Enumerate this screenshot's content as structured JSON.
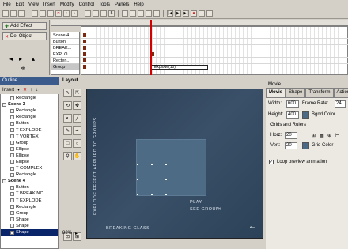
{
  "menu": [
    "File",
    "Edit",
    "View",
    "Insert",
    "Modify",
    "Control",
    "Tools",
    "Panels",
    "Help"
  ],
  "timeline": {
    "add_effect": "Add Effect",
    "del_object": "Del Object",
    "layers": [
      "Scene 4",
      "Button",
      "BREAK...",
      "EXPLO...",
      "Recten...",
      "Group"
    ],
    "tween_label": "Explode(10)"
  },
  "outline": {
    "title": "Outline",
    "insert_label": "Insert",
    "rows": [
      {
        "label": "Rectangle",
        "type": "item"
      },
      {
        "label": "Scene 3",
        "type": "scene"
      },
      {
        "label": "Rectangle",
        "type": "item"
      },
      {
        "label": "Rectangle",
        "type": "item"
      },
      {
        "label": "Button",
        "type": "item"
      },
      {
        "label": "T EXPLODE",
        "type": "item"
      },
      {
        "label": "T VORTEX",
        "type": "item"
      },
      {
        "label": "Group",
        "type": "item"
      },
      {
        "label": "Ellipse",
        "type": "item"
      },
      {
        "label": "Ellipse",
        "type": "item"
      },
      {
        "label": "Ellipse",
        "type": "item"
      },
      {
        "label": "T COMPLEX",
        "type": "item"
      },
      {
        "label": "Rectangle",
        "type": "item"
      },
      {
        "label": "Scene 4",
        "type": "scene"
      },
      {
        "label": "Button",
        "type": "item"
      },
      {
        "label": "T BREAKINC",
        "type": "item"
      },
      {
        "label": "T EXPLODE",
        "type": "item"
      },
      {
        "label": "Rectangle",
        "type": "item"
      },
      {
        "label": "Group",
        "type": "item"
      },
      {
        "label": "Shape",
        "type": "item"
      },
      {
        "label": "Shape",
        "type": "item"
      },
      {
        "label": "Shape",
        "type": "sel"
      }
    ]
  },
  "layout": {
    "title": "Layout",
    "zoom": "82%",
    "stage_vertical_text": "EXPLODE EFFECT APPLIED TO GROUPS",
    "play_label": "PLAY",
    "see_group_label": "SEE GROUP",
    "breaking_glass_label": "BREAKING GLASS"
  },
  "movie": {
    "title": "Movie",
    "tabs": [
      "Movie",
      "Shape",
      "Transform",
      "Action"
    ],
    "width_label": "Width:",
    "width_value": "600",
    "frame_rate_label": "Frame Rate:",
    "frame_rate_value": "24",
    "height_label": "Height:",
    "height_value": "400",
    "bgnd_color_label": "Bgnd Color",
    "grids_label": "Grids and Rulers",
    "horz_label": "Horz:",
    "horz_value": "20",
    "vert_label": "Vert:",
    "vert_value": "20",
    "grid_color_label": "Grid Color",
    "loop_label": "Loop preview animation",
    "bgnd_color": "#4a6a86",
    "grid_color": "#4a6a86"
  }
}
